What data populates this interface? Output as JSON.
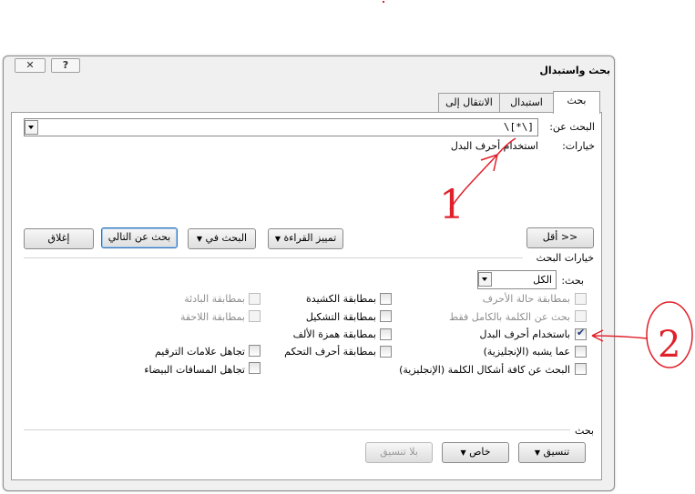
{
  "dialog": {
    "title": "بحث واستبدال",
    "help_icon": "question-mark-icon",
    "close_icon": "close-x-icon"
  },
  "tabs": [
    {
      "label": "بحث",
      "active": true
    },
    {
      "label": "استبدال",
      "active": false
    },
    {
      "label": "الانتقال إلى",
      "active": false
    }
  ],
  "find": {
    "label": "البحث عن:",
    "value": "\\[*\\]",
    "options_label": "خيارات:",
    "options_value": "استخدام أحرف البدل"
  },
  "buttons": {
    "less": "<< أقل",
    "reading_highlight": "تمييز القراءة",
    "find_in": "البحث في",
    "find_next": "بحث عن التالي",
    "close": "إغلاق",
    "format": "تنسيق",
    "special": "خاص",
    "no_format": "بلا تنسيق"
  },
  "search_options": {
    "heading": "خيارات البحث",
    "search_label": "بحث:",
    "search_value": "الكل",
    "col_right": [
      {
        "label": "بمطابقة حالة الأحرف",
        "checked": false,
        "disabled": true
      },
      {
        "label": "بحث عن الكلمة بالكامل فقط",
        "checked": false,
        "disabled": true
      },
      {
        "label": "باستخدام أحرف البدل",
        "checked": true,
        "disabled": false
      },
      {
        "label": "عما يشبه (الإنجليزية)",
        "checked": false,
        "disabled": false
      },
      {
        "label": "البحث عن كافة أشكال الكلمة (الإنجليزية)",
        "checked": false,
        "disabled": false
      }
    ],
    "col_middle": [
      {
        "label": "بمطابقة الكشيدة",
        "checked": false,
        "disabled": false
      },
      {
        "label": "بمطابقة التشكيل",
        "checked": false,
        "disabled": false
      },
      {
        "label": "بمطابقة همزة الألف",
        "checked": false,
        "disabled": false
      },
      {
        "label": "بمطابقة أحرف التحكم",
        "checked": false,
        "disabled": false
      }
    ],
    "col_left": [
      {
        "label": "بمطابقة البادئة",
        "checked": false,
        "disabled": true
      },
      {
        "label": "بمطابقة اللاحقة",
        "checked": false,
        "disabled": true
      },
      {
        "label": "تجاهل علامات الترقيم",
        "checked": false,
        "disabled": false
      },
      {
        "label": "تجاهل المسافات البيضاء",
        "checked": false,
        "disabled": false
      }
    ]
  },
  "find_section_label": "بحث",
  "annotations": {
    "marker_1": "1",
    "marker_2": "2",
    "color": "#e0202a"
  }
}
